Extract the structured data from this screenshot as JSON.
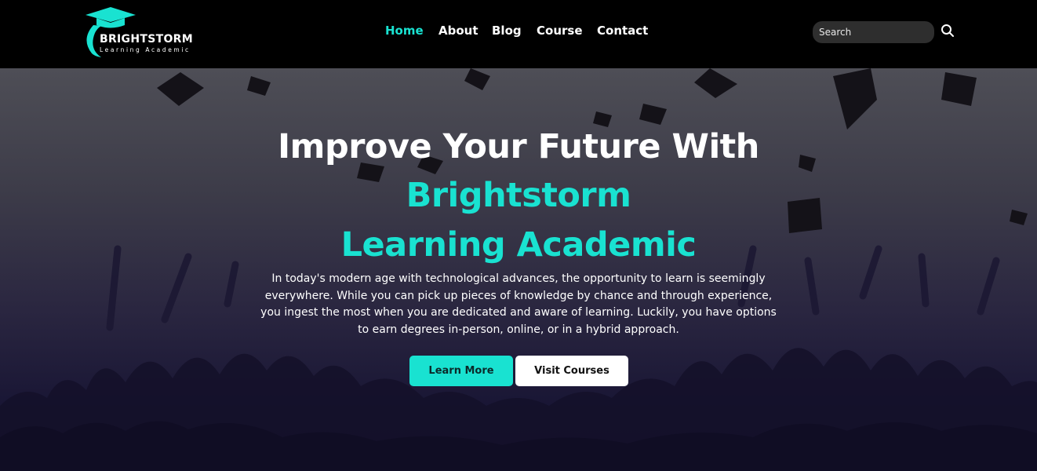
{
  "logo": {
    "name": "BRIGHTSTORM",
    "tagline": "Learning Academic",
    "icon": "graduation-cap-icon"
  },
  "nav": {
    "items": [
      {
        "label": "Home",
        "active": true
      },
      {
        "label": "About",
        "active": false
      },
      {
        "label": "Blog",
        "active": false
      },
      {
        "label": "Course",
        "active": false
      },
      {
        "label": "Contact",
        "active": false
      }
    ]
  },
  "search": {
    "placeholder": "Search",
    "icon": "search-icon"
  },
  "hero": {
    "title": "Improve Your Future With",
    "accent_line1": "Brightstorm",
    "accent_line2": "Learning Academic",
    "description": "In today's modern age with technological advances, the opportunity to learn is seemingly everywhere. While you can pick up pieces of knowledge by chance and through experience, you ingest the most when you are dedicated and aware of learning. Luckily, you have options to earn degrees in-person, online, or in a hybrid approach.",
    "buttons": {
      "learn_more": "Learn More",
      "visit_courses": "Visit Courses"
    }
  },
  "colors": {
    "accent": "#19e2d1",
    "header_bg": "#000000",
    "text": "#ffffff"
  }
}
